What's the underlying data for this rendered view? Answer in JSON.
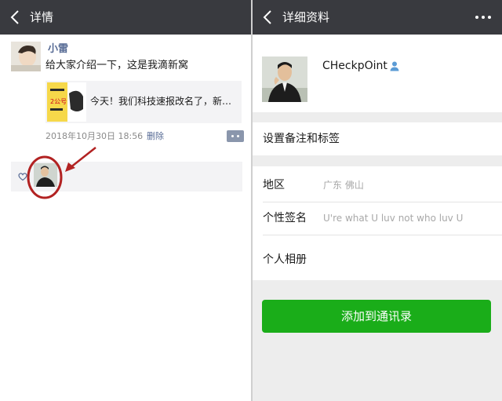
{
  "left": {
    "header": {
      "title": "详情"
    },
    "post": {
      "author": "小雷",
      "text": "给大家介绍一下，这是我滴新窝",
      "share_card": {
        "title": "今天！我们科技速报改名了，新…",
        "thumb_text": "2公号"
      },
      "time": "2018年10月30日 18:56",
      "delete_label": "删除"
    }
  },
  "right": {
    "header": {
      "title": "详细资料"
    },
    "profile": {
      "name": "CHeckpOint"
    },
    "remark_label": "设置备注和标签",
    "region": {
      "label": "地区",
      "value": "广东  佛山"
    },
    "signature": {
      "label": "个性签名",
      "value": "U're what U luv not who luv U"
    },
    "album": {
      "label": "个人相册"
    },
    "add_button": "添加到通讯录"
  },
  "colors": {
    "topbar": "#393a3f",
    "link": "#576b95",
    "primary_green": "#1aad19",
    "annotation_red": "#b22222"
  }
}
